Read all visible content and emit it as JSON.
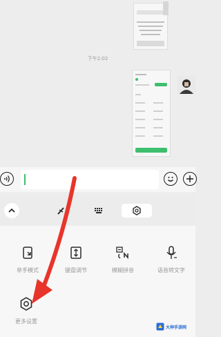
{
  "chat": {
    "timestamp": "下午2:02"
  },
  "input_bar": {
    "voice_icon": "voice-wave-icon",
    "emoji_icon": "emoji-icon",
    "plus_icon": "plus-icon"
  },
  "toolbar": {
    "collapse_icon": "chevron-up-icon",
    "tabs": [
      {
        "icon": "handwrite-pen-icon"
      },
      {
        "icon": "keyboard-icon"
      },
      {
        "icon": "settings-gear-icon",
        "selected": true
      }
    ]
  },
  "panel": {
    "tools": [
      {
        "label": "单手模式",
        "icon": "one-hand-icon"
      },
      {
        "label": "键盘调节",
        "icon": "resize-icon"
      },
      {
        "label": "模糊拼音",
        "icon": "fuzzy-pinyin-icon"
      },
      {
        "label": "语音转文字",
        "icon": "mic-icon"
      },
      {
        "label": "更多设置",
        "icon": "gear-icon"
      }
    ]
  },
  "watermark": {
    "text": "大神手游网"
  },
  "colors": {
    "accent_green": "#3dbf6e",
    "annotation_arrow": "#e8352b"
  }
}
